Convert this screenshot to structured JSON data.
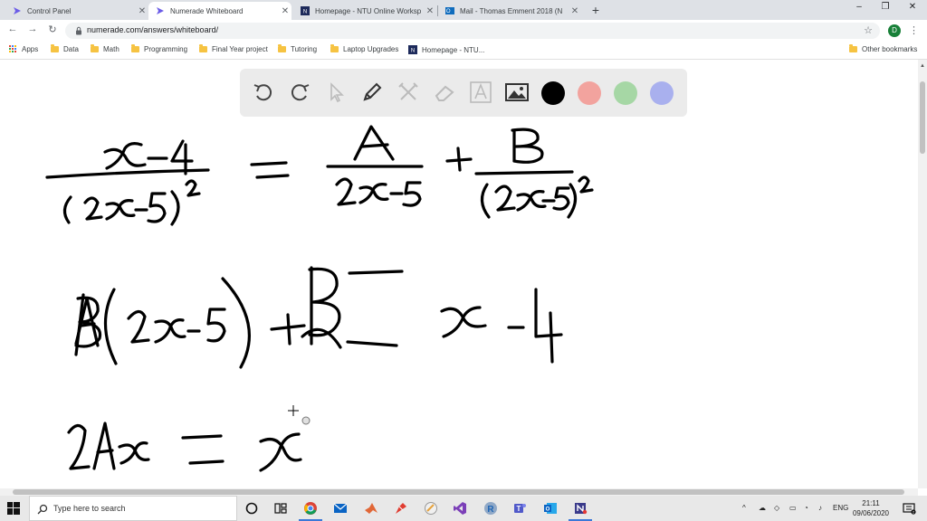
{
  "browser": {
    "tabs": [
      {
        "title": "Control Panel",
        "active": false
      },
      {
        "title": "Numerade Whiteboard",
        "active": true
      },
      {
        "title": "Homepage - NTU Online Worksp",
        "active": false
      },
      {
        "title": "Mail - Thomas Emment 2018 (N",
        "active": false
      }
    ],
    "new_tab": "+",
    "address": "numerade.com/answers/whiteboard/",
    "profile_initial": "D",
    "window_controls": {
      "minimize": "–",
      "maximize": "❐",
      "close": "✕"
    }
  },
  "bookmarks": {
    "items": [
      {
        "label": "Apps",
        "icon": "apps-grid-icon"
      },
      {
        "label": "Data",
        "icon": "folder-icon"
      },
      {
        "label": "Math",
        "icon": "folder-icon"
      },
      {
        "label": "Programming",
        "icon": "folder-icon"
      },
      {
        "label": "Final Year project",
        "icon": "folder-icon"
      },
      {
        "label": "Tutoring",
        "icon": "folder-icon"
      },
      {
        "label": "Laptop Upgrades",
        "icon": "folder-icon"
      },
      {
        "label": "Homepage - NTU...",
        "icon": "ntu-icon"
      }
    ],
    "other": "Other bookmarks"
  },
  "drawbar": {
    "tools": [
      "undo-icon",
      "redo-icon",
      "select-icon",
      "pen-icon",
      "tools-icon",
      "eraser-icon",
      "text-icon",
      "image-icon"
    ],
    "colors": [
      "#000000",
      "#f2a39e",
      "#a6d7a5",
      "#a9b0ee"
    ],
    "selected_color": "#000000"
  },
  "taskbar": {
    "search_placeholder": "Type here to search",
    "apps": [
      "cortana-icon",
      "task-view-icon",
      "chrome-icon",
      "mail-icon",
      "matlab-icon",
      "paint-icon",
      "visual-studio-icon",
      "r-icon",
      "teams-icon",
      "outlook-icon",
      "numerade-icon"
    ],
    "language": "ENG",
    "time": "21:11",
    "date": "09/06/2020"
  }
}
